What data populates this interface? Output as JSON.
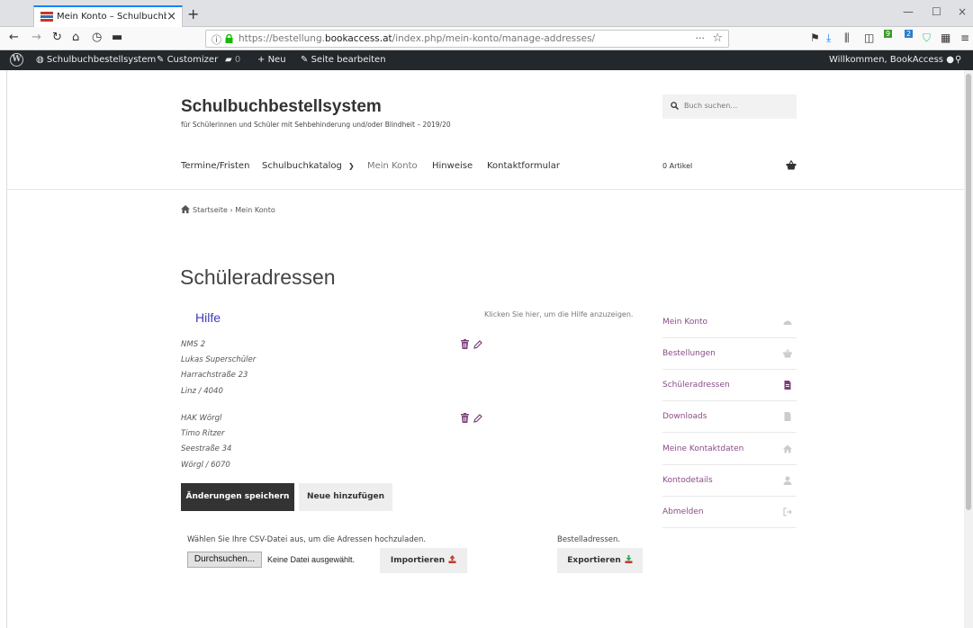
{
  "browser": {
    "tab_title": "Mein Konto – Schulbuchbestell",
    "url_prefix": "https://bestellung.",
    "url_domain": "bookaccess.at",
    "url_path": "/index.php/mein-konto/manage-addresses/",
    "url_more": "···",
    "badge_green": "9",
    "badge_blue": "2"
  },
  "adminbar": {
    "site_name": "Schulbuchbestellsystem",
    "customizer": "Customizer",
    "comments_count": "0",
    "new_label": "Neu",
    "edit_page": "Seite bearbeiten",
    "greeting": "Willkommen, BookAccess"
  },
  "site": {
    "title": "Schulbuchbestellsystem",
    "description": "für Schülerinnen und Schüler mit Sehbehinderung und/oder Blindheit – 2019/20",
    "search_placeholder": "Buch suchen…"
  },
  "nav": {
    "items": [
      {
        "label": "Termine/Fristen"
      },
      {
        "label": "Schulbuchkatalog"
      },
      {
        "label": "Mein Konto"
      },
      {
        "label": "Hinweise"
      },
      {
        "label": "Kontaktformular"
      }
    ],
    "cart_count": "0 Artikel"
  },
  "breadcrumb": {
    "home": "Startseite",
    "separator": "›",
    "current": "Mein Konto"
  },
  "main": {
    "page_title": "Schüleradressen",
    "help_link": "Hilfe",
    "help_hint": "Klicken Sie hier, um die Hilfe anzuzeigen.",
    "addresses": [
      {
        "school": "NMS 2",
        "name": "Lukas Superschüler",
        "street": "Harrachstraße 23",
        "city": "Linz / 4040"
      },
      {
        "school": "HAK Wörgl",
        "name": "Timo Ritzer",
        "street": "Seestraße 34",
        "city": "Wörgl / 6070"
      }
    ],
    "save_label": "Änderungen speichern",
    "add_label": "Neue hinzufügen",
    "csv_label": "Wählen Sie Ihre CSV-Datei aus, um die Adressen hochzuladen.",
    "browse_label": "Durchsuchen...",
    "no_file": "Keine Datei ausgewählt.",
    "import_label": "Importieren",
    "order_label": "Bestelladressen.",
    "export_label": "Exportieren"
  },
  "account_nav": {
    "items": [
      {
        "label": "Mein Konto",
        "icon": "dashboard-icon"
      },
      {
        "label": "Bestellungen",
        "icon": "basket-icon"
      },
      {
        "label": "Schüleradressen",
        "icon": "file-icon"
      },
      {
        "label": "Downloads",
        "icon": "file-icon"
      },
      {
        "label": "Meine Kontaktdaten",
        "icon": "home-icon"
      },
      {
        "label": "Kontodetails",
        "icon": "user-icon"
      },
      {
        "label": "Abmelden",
        "icon": "logout-icon"
      }
    ]
  },
  "colors": {
    "accent_purple": "#8a4b88",
    "help_blue": "#3b3bb5",
    "adminbar_bg": "#23282d",
    "dark_button": "#333333",
    "firefox_blue": "#0a84ff",
    "import_red": "#c0392b",
    "export_green": "#27ae60"
  }
}
